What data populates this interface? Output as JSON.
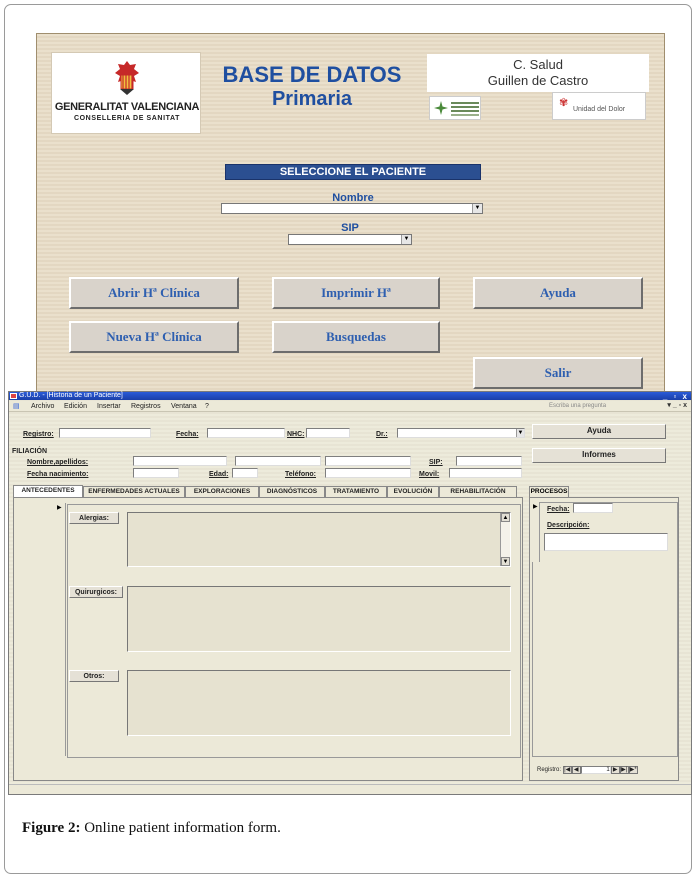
{
  "top_form": {
    "logo": {
      "line1": "GENERALITAT VALENCIANA",
      "line2": "CONSELLERIA DE SANITAT"
    },
    "title": "BASE DE DATOS",
    "subtitle": "Primaria",
    "center": {
      "line1": "C. Salud",
      "line2": "Guillen de Castro"
    },
    "logo_dolor_text": "Unidad del Dolor",
    "select_patient": "SELECCIONE EL PACIENTE",
    "nombre_label": "Nombre",
    "sip_label": "SIP",
    "buttons": {
      "abrir": "Abrir Hª Clínica",
      "imprimir": "Imprimir Hª",
      "ayuda": "Ayuda",
      "nueva": "Nueva Hª Clínica",
      "busquedas": "Busquedas",
      "salir": "Salir"
    },
    "colors": {
      "background": "#e8dcc6",
      "accent_blue": "#1f4fa0",
      "button_text": "#2e5fb0"
    }
  },
  "window": {
    "title": "G.U.D. - [Historia de un Paciente]",
    "controls": "_ ▫ x",
    "menu": [
      "Archivo",
      "Edición",
      "Insertar",
      "Registros",
      "Ventana",
      "?"
    ],
    "help_placeholder": "Escriba una pregunta",
    "menu_right": "▾ _ ▫ x",
    "top_fields": {
      "registro": "Registro:",
      "fecha": "Fecha:",
      "nhc": "NHC:",
      "dr": "Dr.:"
    },
    "side_buttons": {
      "ayuda": "Ayuda",
      "informes": "Informes"
    },
    "filiacion": {
      "section": "FILIACIÓN",
      "nombre": "Nombre,apellidos:",
      "fecha_nac": "Fecha nacimiento:",
      "edad": "Edad:",
      "telefono": "Teléfono:",
      "sip": "SIP:",
      "movil": "Movil:"
    },
    "tabs": [
      "ANTECEDENTES",
      "ENFERMEDADES ACTUALES",
      "EXPLORACIONES",
      "DIAGNÓSTICOS",
      "TRATAMIENTO",
      "EVOLUCIÓN",
      "REHABILITACIÓN"
    ],
    "active_tab": "ANTECEDENTES",
    "antecedentes": {
      "alergias": "Alergias:",
      "quirurgicos": "Quirurgicos:",
      "otros": "Otros:"
    },
    "procesos": {
      "tab": "PROCESOS",
      "fecha": "Fecha:",
      "descripcion": "Descripción:"
    },
    "nav": {
      "label": "Registro:",
      "current": "1"
    }
  },
  "caption": {
    "label": "Figure 2:",
    "text": " Online patient information form."
  }
}
